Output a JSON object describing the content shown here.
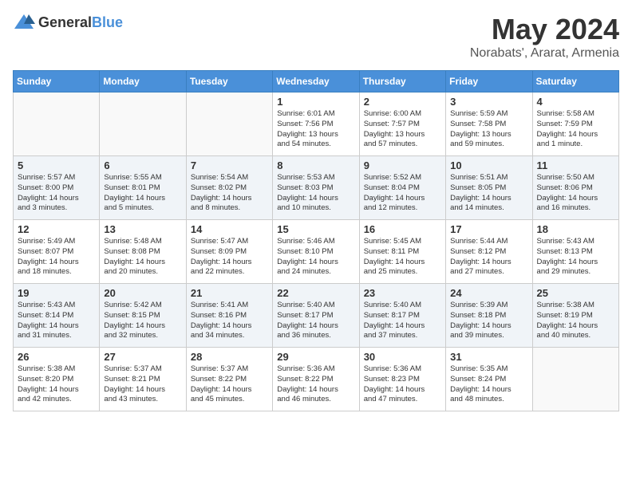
{
  "header": {
    "logo_general": "General",
    "logo_blue": "Blue",
    "month_title": "May 2024",
    "location": "Norabats', Ararat, Armenia"
  },
  "calendar": {
    "days_of_week": [
      "Sunday",
      "Monday",
      "Tuesday",
      "Wednesday",
      "Thursday",
      "Friday",
      "Saturday"
    ],
    "weeks": [
      [
        {
          "day": "",
          "info": ""
        },
        {
          "day": "",
          "info": ""
        },
        {
          "day": "",
          "info": ""
        },
        {
          "day": "1",
          "info": "Sunrise: 6:01 AM\nSunset: 7:56 PM\nDaylight: 13 hours\nand 54 minutes."
        },
        {
          "day": "2",
          "info": "Sunrise: 6:00 AM\nSunset: 7:57 PM\nDaylight: 13 hours\nand 57 minutes."
        },
        {
          "day": "3",
          "info": "Sunrise: 5:59 AM\nSunset: 7:58 PM\nDaylight: 13 hours\nand 59 minutes."
        },
        {
          "day": "4",
          "info": "Sunrise: 5:58 AM\nSunset: 7:59 PM\nDaylight: 14 hours\nand 1 minute."
        }
      ],
      [
        {
          "day": "5",
          "info": "Sunrise: 5:57 AM\nSunset: 8:00 PM\nDaylight: 14 hours\nand 3 minutes."
        },
        {
          "day": "6",
          "info": "Sunrise: 5:55 AM\nSunset: 8:01 PM\nDaylight: 14 hours\nand 5 minutes."
        },
        {
          "day": "7",
          "info": "Sunrise: 5:54 AM\nSunset: 8:02 PM\nDaylight: 14 hours\nand 8 minutes."
        },
        {
          "day": "8",
          "info": "Sunrise: 5:53 AM\nSunset: 8:03 PM\nDaylight: 14 hours\nand 10 minutes."
        },
        {
          "day": "9",
          "info": "Sunrise: 5:52 AM\nSunset: 8:04 PM\nDaylight: 14 hours\nand 12 minutes."
        },
        {
          "day": "10",
          "info": "Sunrise: 5:51 AM\nSunset: 8:05 PM\nDaylight: 14 hours\nand 14 minutes."
        },
        {
          "day": "11",
          "info": "Sunrise: 5:50 AM\nSunset: 8:06 PM\nDaylight: 14 hours\nand 16 minutes."
        }
      ],
      [
        {
          "day": "12",
          "info": "Sunrise: 5:49 AM\nSunset: 8:07 PM\nDaylight: 14 hours\nand 18 minutes."
        },
        {
          "day": "13",
          "info": "Sunrise: 5:48 AM\nSunset: 8:08 PM\nDaylight: 14 hours\nand 20 minutes."
        },
        {
          "day": "14",
          "info": "Sunrise: 5:47 AM\nSunset: 8:09 PM\nDaylight: 14 hours\nand 22 minutes."
        },
        {
          "day": "15",
          "info": "Sunrise: 5:46 AM\nSunset: 8:10 PM\nDaylight: 14 hours\nand 24 minutes."
        },
        {
          "day": "16",
          "info": "Sunrise: 5:45 AM\nSunset: 8:11 PM\nDaylight: 14 hours\nand 25 minutes."
        },
        {
          "day": "17",
          "info": "Sunrise: 5:44 AM\nSunset: 8:12 PM\nDaylight: 14 hours\nand 27 minutes."
        },
        {
          "day": "18",
          "info": "Sunrise: 5:43 AM\nSunset: 8:13 PM\nDaylight: 14 hours\nand 29 minutes."
        }
      ],
      [
        {
          "day": "19",
          "info": "Sunrise: 5:43 AM\nSunset: 8:14 PM\nDaylight: 14 hours\nand 31 minutes."
        },
        {
          "day": "20",
          "info": "Sunrise: 5:42 AM\nSunset: 8:15 PM\nDaylight: 14 hours\nand 32 minutes."
        },
        {
          "day": "21",
          "info": "Sunrise: 5:41 AM\nSunset: 8:16 PM\nDaylight: 14 hours\nand 34 minutes."
        },
        {
          "day": "22",
          "info": "Sunrise: 5:40 AM\nSunset: 8:17 PM\nDaylight: 14 hours\nand 36 minutes."
        },
        {
          "day": "23",
          "info": "Sunrise: 5:40 AM\nSunset: 8:17 PM\nDaylight: 14 hours\nand 37 minutes."
        },
        {
          "day": "24",
          "info": "Sunrise: 5:39 AM\nSunset: 8:18 PM\nDaylight: 14 hours\nand 39 minutes."
        },
        {
          "day": "25",
          "info": "Sunrise: 5:38 AM\nSunset: 8:19 PM\nDaylight: 14 hours\nand 40 minutes."
        }
      ],
      [
        {
          "day": "26",
          "info": "Sunrise: 5:38 AM\nSunset: 8:20 PM\nDaylight: 14 hours\nand 42 minutes."
        },
        {
          "day": "27",
          "info": "Sunrise: 5:37 AM\nSunset: 8:21 PM\nDaylight: 14 hours\nand 43 minutes."
        },
        {
          "day": "28",
          "info": "Sunrise: 5:37 AM\nSunset: 8:22 PM\nDaylight: 14 hours\nand 45 minutes."
        },
        {
          "day": "29",
          "info": "Sunrise: 5:36 AM\nSunset: 8:22 PM\nDaylight: 14 hours\nand 46 minutes."
        },
        {
          "day": "30",
          "info": "Sunrise: 5:36 AM\nSunset: 8:23 PM\nDaylight: 14 hours\nand 47 minutes."
        },
        {
          "day": "31",
          "info": "Sunrise: 5:35 AM\nSunset: 8:24 PM\nDaylight: 14 hours\nand 48 minutes."
        },
        {
          "day": "",
          "info": ""
        }
      ]
    ]
  }
}
